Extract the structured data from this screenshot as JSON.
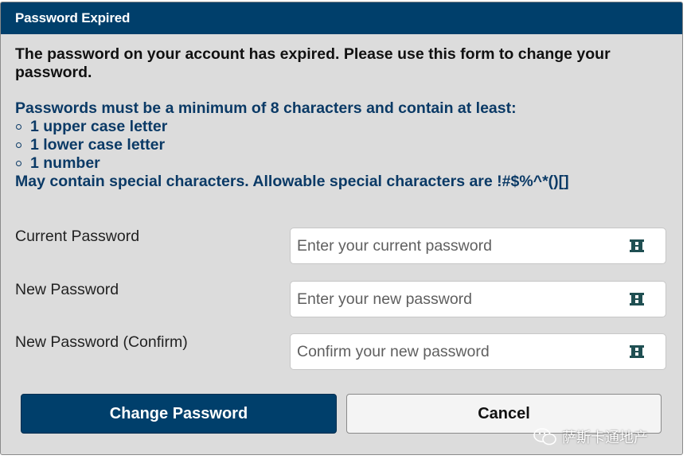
{
  "dialog": {
    "title": "Password Expired",
    "intro": "The password on your account has expired. Please use this form to change your password.",
    "requirements": {
      "heading": "Passwords must be a minimum of 8 characters and contain at least:",
      "items": [
        "1 upper case letter",
        "1 lower case letter",
        "1 number"
      ],
      "special_note": "May contain special characters. Allowable special characters are !#$%^*()[]"
    }
  },
  "form": {
    "current": {
      "label": "Current Password",
      "placeholder": "Enter your current password",
      "icon": "eye-reveal-icon"
    },
    "new": {
      "label": "New Password",
      "placeholder": "Enter your new password",
      "icon": "eye-reveal-icon"
    },
    "confirm": {
      "label": "New Password (Confirm)",
      "placeholder": "Confirm your new password",
      "icon": "eye-reveal-icon"
    }
  },
  "buttons": {
    "submit_label": "Change Password",
    "cancel_label": "Cancel"
  },
  "watermark": {
    "text": "萨斯卡通地产"
  },
  "colors": {
    "title_bar": "#003f6b",
    "dialog_bg": "#dcdcdc",
    "requirements_text": "#0b3a66",
    "icon": "#1f4f52"
  }
}
